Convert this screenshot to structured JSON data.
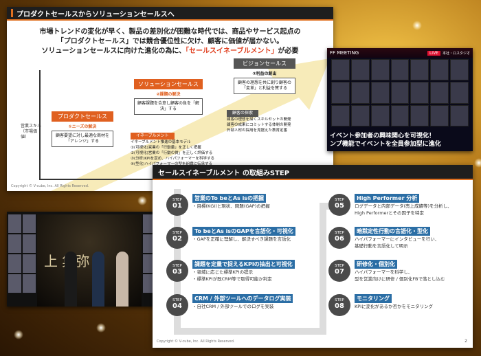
{
  "colors": {
    "accent": "#e07020",
    "stage_orange": "#e06020",
    "step_title_bg": "#2b6ea5",
    "dark_header": "#1e1e1e"
  },
  "slide1": {
    "title": "プロダクトセールスからソリューションセールスへ",
    "intro_line1": "市場トレンドの変化が早く、製品の差別化が困難な時代では、商品やサービス起点の",
    "intro_line2": "「プロダクトセールス」では競合優位性に欠け、顧客に価値が届かない。",
    "intro_line3_pre": "ソリューションセールスに向けた進化の為に、",
    "intro_line3_hl": "「セールスイネーブルメント」",
    "intro_line3_post": "が必要",
    "ylabel": "営業スキル（市場価値）",
    "stage1": {
      "title": "プロダクトセールス",
      "sub": "①ニーズの解決",
      "box": "顧客要望に対し最適な商材を「アレンジ」する"
    },
    "stage2": {
      "title": "ソリューションセールス",
      "sub": "②課題の解決",
      "box": "顧客課題を合意し顧客の負を「解決」する"
    },
    "stage3": {
      "title": "ビジョンセールス",
      "sub": "③利益の創出",
      "box": "顧客の理想を共に創り顧客の「変革」と利益を賛する"
    },
    "enable_tag": "イネーブルメント",
    "enable_title": "イネーブルメント推進の基本モデル",
    "enable_items": [
      "①(可視化)営業の「行動量」を正しく把握",
      "②(可視化)営業の「行動の質」を正しく評価する",
      "③(分析)KPIを定め、ハイパフォーマーを科学する",
      "④(型化)ハイパフォーマーの型を組織に伝承する"
    ],
    "customer_tag": "顧客の探索",
    "customer_items": [
      "顧客の理想を描くスキルセットの開発",
      "顧客の成果にコミットする体制の開発",
      "外部人材の採用を見据えた教育定番"
    ],
    "copyright": "Copyright © V-cube, Inc. All Rights Reserved."
  },
  "video1": {
    "banner": "FF MEETING",
    "live": "LIVE",
    "sub_banner": "本社・ロスタジオ",
    "caption_line1": "イベント参加者の興味関心を可視化！",
    "caption_line2": "ンプ機能でイベントを全員参加型に進化"
  },
  "video2": {
    "stage_text": "上 集弥"
  },
  "slide2": {
    "title": "セールスイネーブルメント の取組みSTEP",
    "step_label": "STEP",
    "steps": [
      {
        "num": "01",
        "title": "営業のTo beとAs isの把握",
        "desc": "・目標(KGI)と現状、問題(GAP)の把握"
      },
      {
        "num": "02",
        "title": "To beとAs isのGAPを言語化・可視化",
        "desc": "・GAPを正確に理解し、解決すべき課題を言語化"
      },
      {
        "num": "03",
        "title": "課題を定量で捉えるKPIの抽出と可視化",
        "desc": "・領域に応じた標準KPIの提示\n・標準KPIが既CRM等で取得可能か判定"
      },
      {
        "num": "04",
        "title": "CRM / 外部ツールへのデータログ実装",
        "desc": "・自社CRM / 外部ツールでのログを実装"
      },
      {
        "num": "05",
        "title": "High Performer 分析",
        "desc": "ログデータと内部データ(売上成績等)を分析し、\nHigh Performerとその因子を特定"
      },
      {
        "num": "06",
        "title": "暗黙定性行動の言語化・型化",
        "desc": "ハイパフォーマーにインタビューを行い、\n基礎行動を言語化して明示"
      },
      {
        "num": "07",
        "title": "研修化・個別化",
        "desc": "ハイパフォーマーを科学し、\n型を営業向けに研修 / 個別化FBで落とし込む"
      },
      {
        "num": "08",
        "title": "モニタリング",
        "desc": "KPIに変化があるか否かをモニタリング"
      }
    ],
    "copyright": "Copyright © V-cube, Inc. All Rights Reserved.",
    "page": "2"
  }
}
